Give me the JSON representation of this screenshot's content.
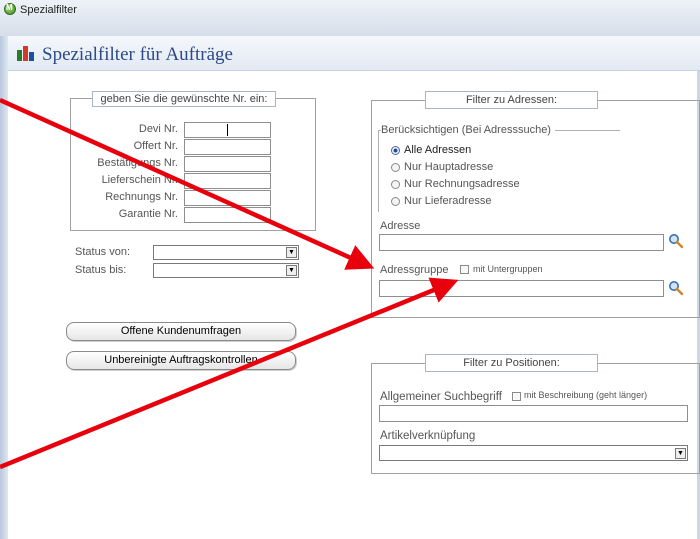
{
  "window": {
    "title": "Spezialfilter"
  },
  "header": {
    "title": "Spezialfilter für Aufträge"
  },
  "nr_group": {
    "legend": "geben Sie die gewünschte Nr. ein:",
    "fields": [
      {
        "label": "Devi Nr."
      },
      {
        "label": "Offert Nr."
      },
      {
        "label": "Bestätigungs Nr."
      },
      {
        "label": "Lieferschein Nr."
      },
      {
        "label": "Rechnungs Nr."
      },
      {
        "label": "Garantie Nr."
      }
    ]
  },
  "status": {
    "from_label": "Status von:",
    "to_label": "Status bis:"
  },
  "buttons": {
    "customer_surveys": "Offene Kundenumfragen",
    "order_checks": "Unbereinigte Auftragskontrollen"
  },
  "address_filter": {
    "legend": "Filter zu Adressen:",
    "consider_legend": "Berücksichtigen (Bei Adresssuche)",
    "options": [
      {
        "label": "Alle Adressen",
        "selected": true
      },
      {
        "label": "Nur Hauptadresse",
        "selected": false
      },
      {
        "label": "Nur Rechnungsadresse",
        "selected": false
      },
      {
        "label": "Nur Lieferadresse",
        "selected": false
      }
    ],
    "address_label": "Adresse",
    "group_label": "Adressgruppe",
    "subgroups_label": "mit Untergruppen"
  },
  "position_filter": {
    "legend": "Filter zu Positionen:",
    "search_label": "Allgemeiner Suchbegriff",
    "description_label": "mit Beschreibung (geht länger)",
    "article_label": "Artikelverknüpfung"
  },
  "colors": {
    "header_text": "#2c4a86",
    "arrow": "#e8000d",
    "radio_selected": "#1f4ea0"
  }
}
